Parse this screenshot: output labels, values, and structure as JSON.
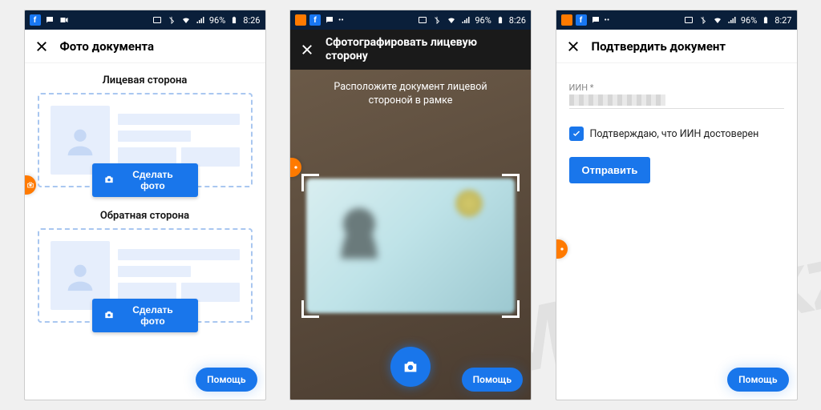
{
  "statusbar": {
    "battery": "96%",
    "time1": "8:26",
    "time2": "8:26",
    "time3": "8:27"
  },
  "screen1": {
    "title": "Фото документа",
    "front_label": "Лицевая сторона",
    "back_label": "Обратная сторона",
    "take_photo": "Сделать фото",
    "help": "Помощь"
  },
  "screen2": {
    "title": "Сфотографировать лицевую сторону",
    "hint": "Расположите документ лицевой стороной в рамке",
    "help": "Помощь"
  },
  "screen3": {
    "title": "Подтвердить документ",
    "iin_label": "ИИН *",
    "confirm_text": "Подтверждаю, что ИИН достоверен",
    "submit": "Отправить",
    "help": "Помощь"
  },
  "watermark": "MHelp.kz"
}
